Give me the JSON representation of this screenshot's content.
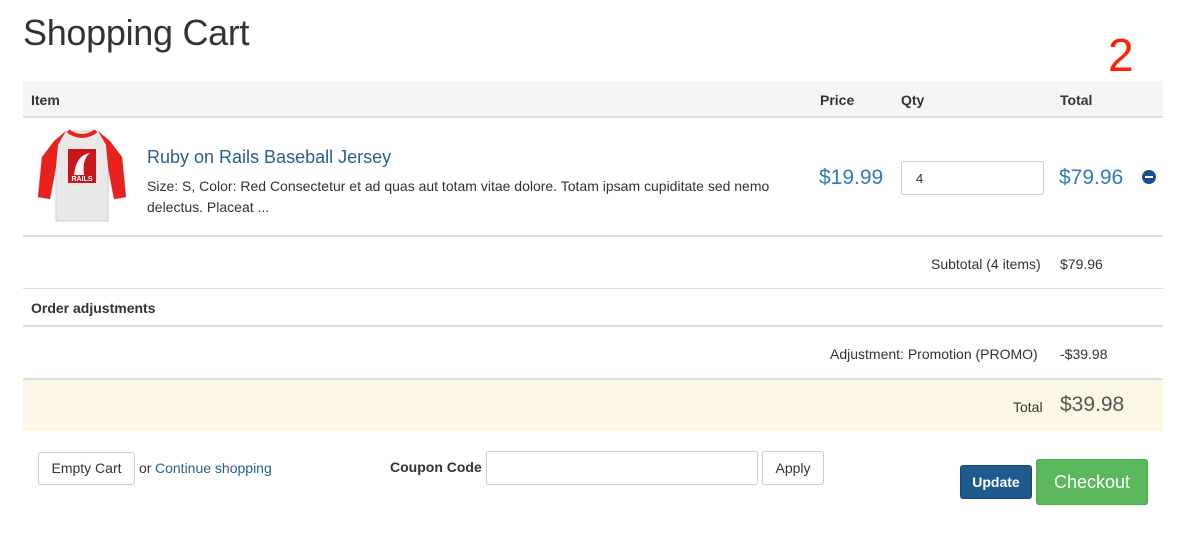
{
  "page": {
    "title": "Shopping Cart",
    "cart_count": "2"
  },
  "table": {
    "headers": {
      "item": "Item",
      "price": "Price",
      "qty": "Qty",
      "total": "Total"
    }
  },
  "line_item": {
    "name": "Ruby on Rails Baseball Jersey",
    "description": "Size: S, Color: Red Consectetur et ad quas aut totam vitae dolore. Totam ipsam cupiditate sed nemo delectus. Placeat ...",
    "price": "$19.99",
    "quantity": "4",
    "total": "$79.96",
    "image_text": "RAILS"
  },
  "summary": {
    "subtotal_label": "Subtotal (4 items)",
    "subtotal_value": "$79.96",
    "adjustments_heading": "Order adjustments",
    "adjustment_label": "Adjustment: Promotion (PROMO)",
    "adjustment_value": "-$39.98",
    "total_label": "Total",
    "total_value": "$39.98"
  },
  "actions": {
    "empty_cart": "Empty Cart",
    "or_text": "or",
    "continue_shopping": "Continue shopping",
    "coupon_label": "Coupon Code",
    "coupon_placeholder": "",
    "apply": "Apply",
    "update": "Update",
    "checkout": "Checkout"
  },
  "colors": {
    "link": "#286090",
    "price": "#337ab7",
    "total_row_bg": "#fcf8e3",
    "update_btn": "#1e5a8e",
    "checkout_btn": "#5cb85c",
    "cart_count": "#ff2200"
  }
}
